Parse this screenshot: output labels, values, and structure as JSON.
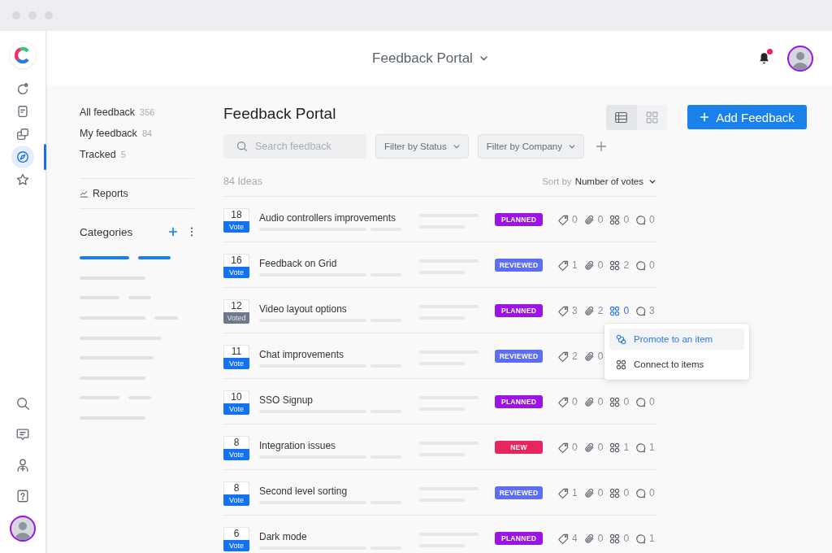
{
  "rail": {
    "top": [
      {
        "kind": "refresh",
        "selected": false
      },
      {
        "kind": "document",
        "selected": false
      },
      {
        "kind": "layers",
        "selected": false
      },
      {
        "kind": "compass",
        "selected": true
      },
      {
        "kind": "star",
        "selected": false
      }
    ],
    "bottom": [
      {
        "kind": "search",
        "selected": false
      },
      {
        "kind": "chat",
        "selected": false
      },
      {
        "kind": "add-user",
        "selected": false
      },
      {
        "kind": "help",
        "selected": false
      }
    ]
  },
  "header": {
    "title": "Feedback Portal",
    "notifications_unread": true
  },
  "sidebar": {
    "views": [
      {
        "label": "All feedback",
        "count": "356"
      },
      {
        "label": "My feedback",
        "count": "84"
      },
      {
        "label": "Tracked",
        "count": "5"
      }
    ],
    "reports": "Reports",
    "categories": "Categories"
  },
  "main": {
    "title": "Feedback Portal",
    "view_toggle": [
      {
        "kind": "list",
        "selected": true
      },
      {
        "kind": "grid",
        "selected": false
      }
    ],
    "add_button": "Add Feedback",
    "search": {
      "placeholder": "Search feedback"
    },
    "filters": [
      "Filter by Status",
      "Filter by Company"
    ],
    "idea_count": "84 Ideas",
    "sort": {
      "label": "Sort by",
      "value": "Number of votes"
    }
  },
  "rows": [
    {
      "votes": "18",
      "vote_label": "Vote",
      "voted": false,
      "title": "Audio controllers improvements",
      "status": {
        "label": "PLANNED",
        "color": "#9b14e5"
      },
      "tags": "0",
      "attachments": "0",
      "connections": "0",
      "connections_open": false,
      "comments": "0"
    },
    {
      "votes": "16",
      "vote_label": "Vote",
      "voted": false,
      "title": "Feedback on Grid",
      "status": {
        "label": "REVIEWED",
        "color": "#5b6ef5"
      },
      "tags": "1",
      "attachments": "0",
      "connections": "2",
      "connections_open": false,
      "comments": "0"
    },
    {
      "votes": "12",
      "vote_label": "Voted",
      "voted": true,
      "title": "Video layout options",
      "status": {
        "label": "PLANNED",
        "color": "#9b14e5"
      },
      "tags": "3",
      "attachments": "2",
      "connections": "0",
      "connections_open": true,
      "comments": "3"
    },
    {
      "votes": "11",
      "vote_label": "Vote",
      "voted": false,
      "title": "Chat improvements",
      "status": {
        "label": "REVIEWED",
        "color": "#5b6ef5"
      },
      "tags": "2",
      "attachments": "0",
      "connections_open": false
    },
    {
      "votes": "10",
      "vote_label": "Vote",
      "voted": false,
      "title": "SSO Signup",
      "status": {
        "label": "PLANNED",
        "color": "#9b14e5"
      },
      "tags": "0",
      "attachments": "0",
      "connections": "0",
      "connections_open": false,
      "comments": "0"
    },
    {
      "votes": "8",
      "vote_label": "Vote",
      "voted": false,
      "title": "Integration issues",
      "status": {
        "label": "NEW",
        "color": "#e8265e"
      },
      "tags": "0",
      "attachments": "0",
      "connections": "1",
      "connections_open": false,
      "comments": "1"
    },
    {
      "votes": "8",
      "vote_label": "Vote",
      "voted": false,
      "title": "Second level sorting",
      "status": {
        "label": "REVIEWED",
        "color": "#5b6ef5"
      },
      "tags": "1",
      "attachments": "0",
      "connections": "0",
      "connections_open": false,
      "comments": "0"
    },
    {
      "votes": "6",
      "vote_label": "Vote",
      "voted": false,
      "title": "Dark mode",
      "status": {
        "label": "PLANNED",
        "color": "#9b14e5"
      },
      "tags": "4",
      "attachments": "0",
      "connections": "0",
      "connections_open": false,
      "comments": "1"
    }
  ],
  "connection_menu": {
    "items": [
      {
        "kind": "promote",
        "label": "Promote to an item",
        "selected": true
      },
      {
        "kind": "connect",
        "label": "Connect to items",
        "selected": false
      }
    ]
  }
}
